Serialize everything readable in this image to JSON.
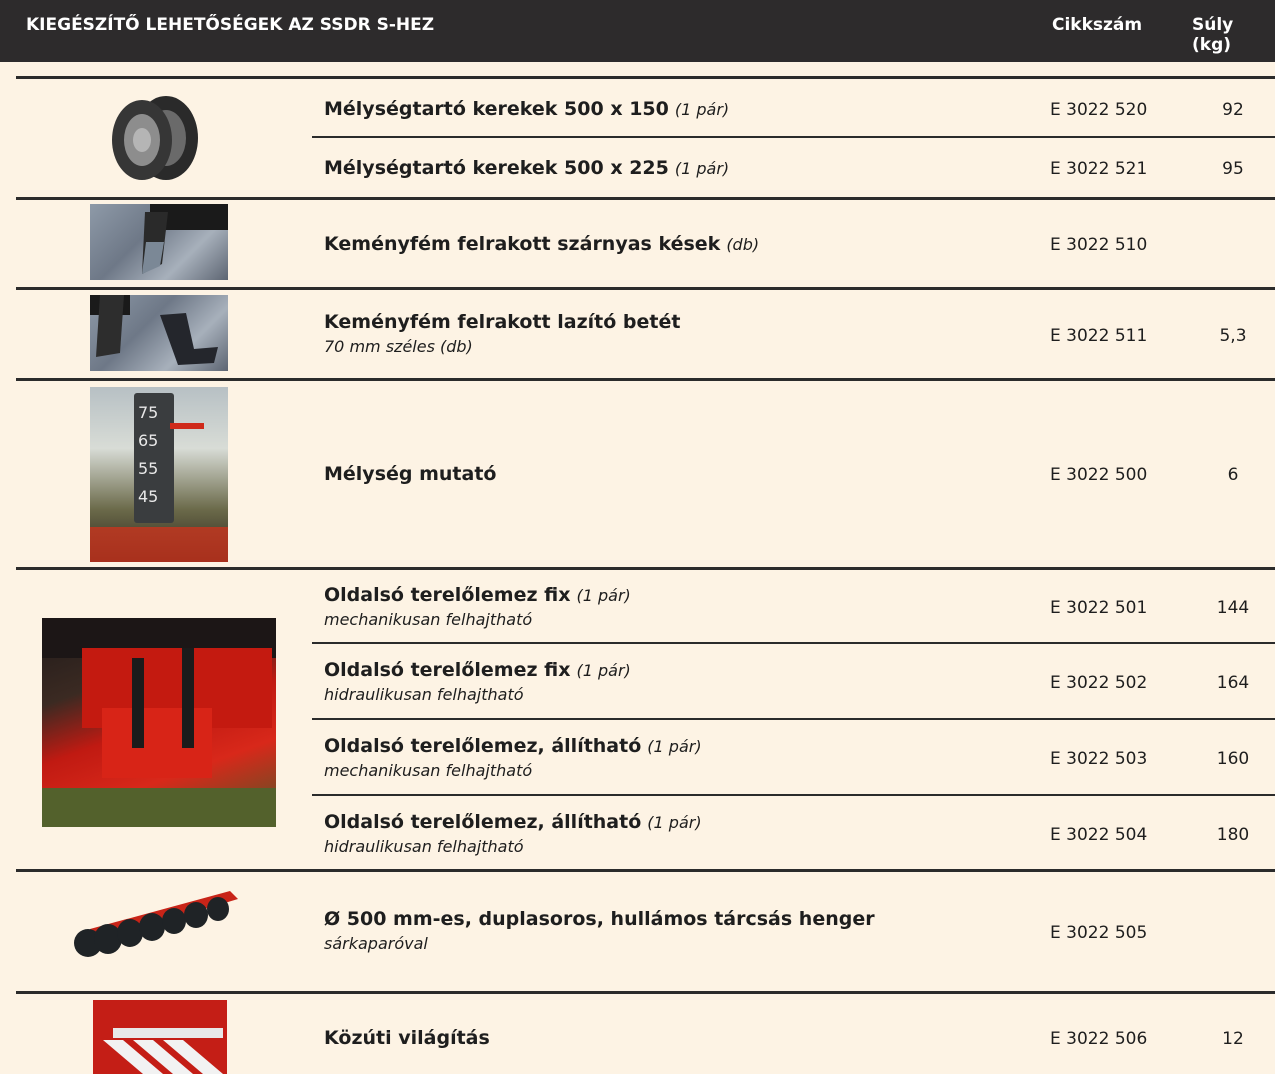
{
  "header": {
    "title": "KIEGÉSZÍTŐ LEHETŐSÉGEK AZ SSDR S-HEZ",
    "code_label": "Cikkszám",
    "weight_label": "Súly (kg)"
  },
  "items": [
    {
      "name": "Mélységtartó kerekek 500 x 150",
      "qty": "(1 pár)",
      "sub": "",
      "code": "E 3022 520",
      "weight": "92"
    },
    {
      "name": "Mélységtartó kerekek 500 x 225",
      "qty": "(1 pár)",
      "sub": "",
      "code": "E 3022 521",
      "weight": "95"
    },
    {
      "name": "Keményfém felrakott szárnyas kések",
      "qty": "(db)",
      "sub": "",
      "code": "E 3022 510",
      "weight": ""
    },
    {
      "name": "Keményfém felrakott lazító betét",
      "qty": "",
      "sub": "70 mm széles (db)",
      "code": "E 3022 511",
      "weight": "5,3"
    },
    {
      "name": "Mélység mutató",
      "qty": "",
      "sub": "",
      "code": "E 3022 500",
      "weight": "6"
    },
    {
      "name": "Oldalsó terelőlemez fix",
      "qty": "(1 pár)",
      "sub": "mechanikusan felhajtható",
      "code": "E 3022 501",
      "weight": "144"
    },
    {
      "name": "Oldalsó terelőlemez fix",
      "qty": "(1 pár)",
      "sub": "hidraulikusan felhajtható",
      "code": "E 3022 502",
      "weight": "164"
    },
    {
      "name": "Oldalsó terelőlemez, állítható",
      "qty": "(1 pár)",
      "sub": "mechanikusan felhajtható",
      "code": "E 3022 503",
      "weight": "160"
    },
    {
      "name": "Oldalsó terelőlemez, állítható",
      "qty": "(1 pár)",
      "sub": "hidraulikusan felhajtható",
      "code": "E 3022 504",
      "weight": "180"
    },
    {
      "name": "Ø 500 mm-es, duplasoros, hullámos tárcsás henger",
      "qty": "",
      "sub": "sárkaparóval",
      "code": "E 3022 505",
      "weight": ""
    },
    {
      "name": "Közúti világítás",
      "qty": "",
      "sub": "",
      "code": "E 3022 506",
      "weight": "12"
    }
  ],
  "gauge_numbers": [
    "75",
    "65",
    "55",
    "45"
  ]
}
